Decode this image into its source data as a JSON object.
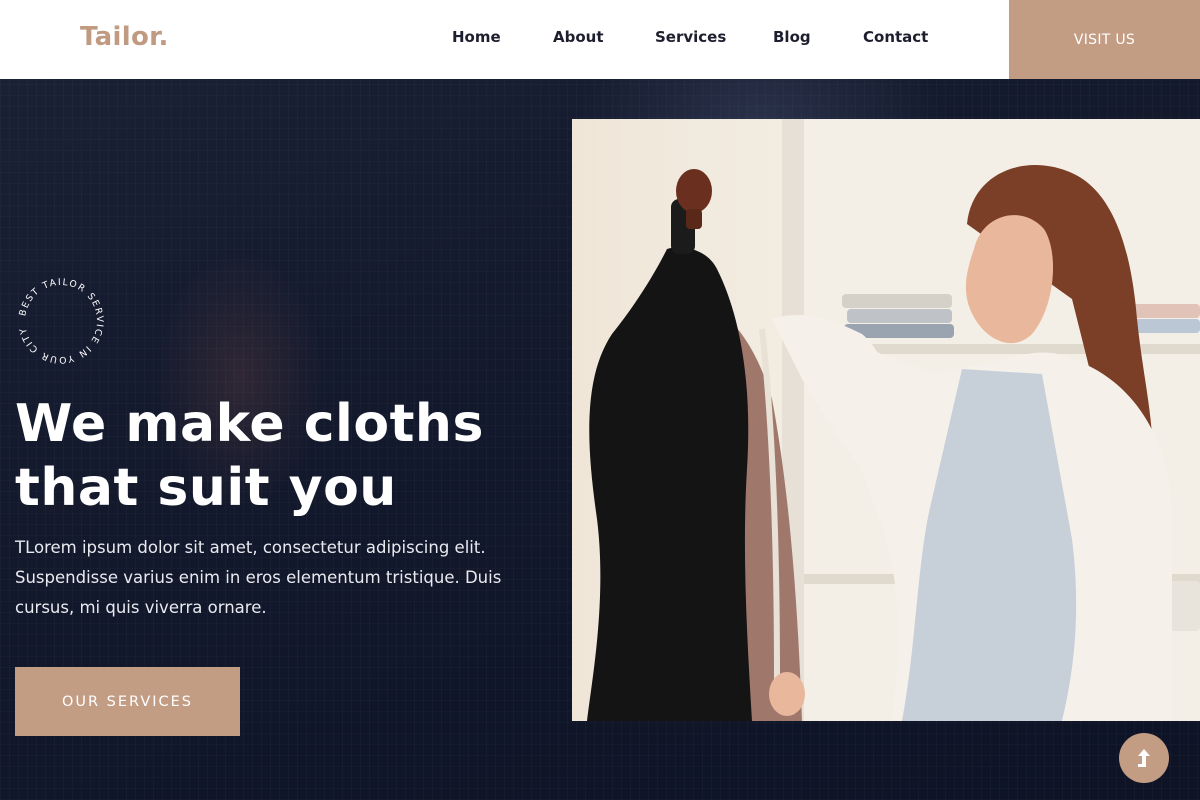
{
  "nav": {
    "logo": "Tailor.",
    "links": [
      "Home",
      "About",
      "Services",
      "Blog",
      "Contact"
    ],
    "cta_label": "VISIT US"
  },
  "hero": {
    "badge_text": "BEST TAILOR SERVICE IN YOUR CITY",
    "title": "We make cloths that suit you",
    "description": "TLorem ipsum dolor sit amet, consectetur adipiscing elit. Suspendisse varius enim in eros elementum tristique. Duis cursus, mi quis viverra ornare.",
    "button_label": "OUR SERVICES",
    "image": "tailor-with-mannequin-photo"
  },
  "scroll_top": {
    "icon": "arrow-up-icon"
  },
  "colors": {
    "accent": "#c39c84",
    "logo": "#c19a82",
    "nav_text": "#1d1f2e",
    "hero_bg": "#141a2d"
  }
}
